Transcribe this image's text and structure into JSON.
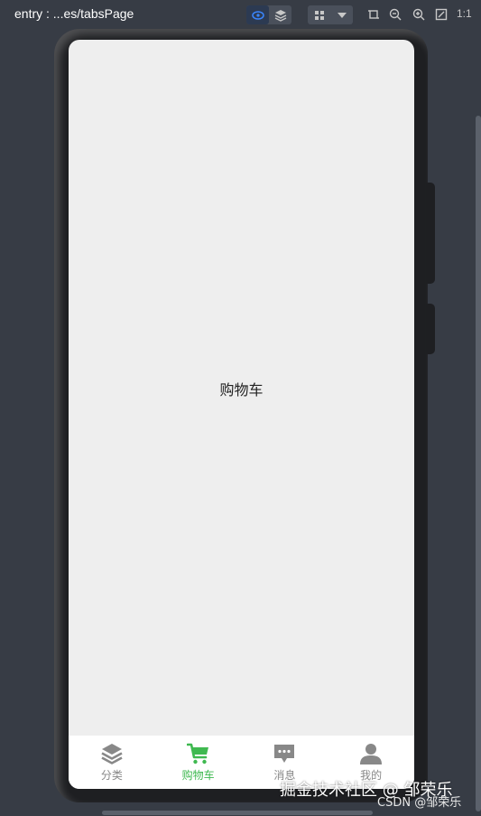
{
  "toolbar": {
    "entry_title": "entry : ...es/tabsPage",
    "one_to_one": "1:1"
  },
  "screen": {
    "content_label": "购物车"
  },
  "tabs": [
    {
      "label": "分类",
      "icon": "layers-icon",
      "active": false
    },
    {
      "label": "购物车",
      "icon": "cart-icon",
      "active": true
    },
    {
      "label": "消息",
      "icon": "message-icon",
      "active": false
    },
    {
      "label": "我的",
      "icon": "user-icon",
      "active": false
    }
  ],
  "watermark": {
    "line1": "掘金技术社区 @ 邹荣乐",
    "line2": "CSDN @邹荣乐"
  },
  "colors": {
    "background": "#373c45",
    "active_tab": "#3fb950",
    "inactive_tab": "#888888",
    "screen_bg": "#eeeeee"
  }
}
